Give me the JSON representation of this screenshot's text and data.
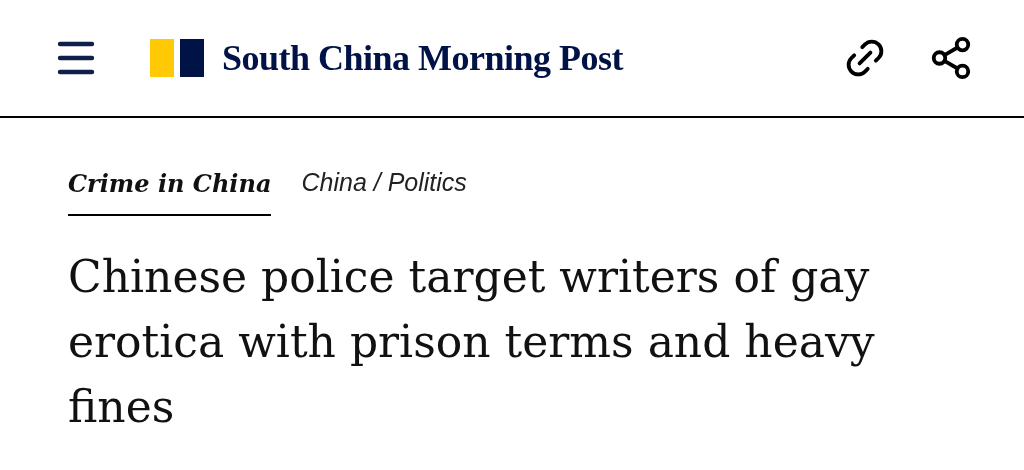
{
  "header": {
    "logo_text": "South China Morning Post"
  },
  "topic": {
    "label": "Crime in China",
    "breadcrumb": "China / Politics"
  },
  "headline": "Chinese police target writers of gay erotica with prison terms and heavy fines"
}
